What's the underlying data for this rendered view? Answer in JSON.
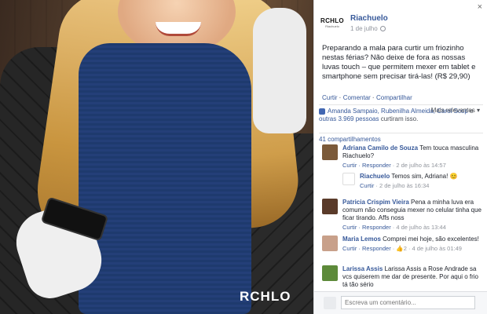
{
  "photo": {
    "logo_text": "RCHLO"
  },
  "panel": {
    "close_glyph": "×",
    "page": {
      "avatar_brand": "RCHLO",
      "avatar_sub": "Riachuelo",
      "name": "Riachuelo",
      "date": "1 de julho",
      "privacy_icon": "globe-icon"
    },
    "post_text": "Preparando a mala para curtir um friozinho nestas férias? Não deixe de fora as nossas luvas touch – que permitem mexer em tablet e smartphone sem precisar tirá-las! (R$ 29,90)",
    "actions": {
      "like": "Curtir",
      "comment": "Comentar",
      "share": "Compartilhar",
      "separator": "·"
    },
    "likes": {
      "names": "Amanda Sampaio, Rubenilha Almeida, Carol Scop",
      "connector": " e ",
      "others": "outras 3.969 pessoas",
      "suffix": " curtiram isso.",
      "sort_label": "Mais relevantes ▾"
    },
    "shares": "41 compartilhamentos",
    "comments": [
      {
        "author": "Adriana Camilo de Souza",
        "text": "Tem touca masculina Riachuelo?",
        "reply_label": "Curtir · Responder",
        "time": " · 2 de julho às 14:57",
        "avatar_color": "#7b5a3a"
      },
      {
        "author": "Patricia Crispim Vieira",
        "text": "Pena a minha luva era comum não conseguia mexer no celular tinha que ficar tirando. Affs noss",
        "reply_label": "Curtir · Responder",
        "time": " · 4 de julho às 13:44",
        "avatar_color": "#5a3b2a"
      },
      {
        "author": "Maria Lemos",
        "text": "Comprei mei hoje, são excelentes!",
        "reply_label": "Curtir · Responder",
        "time": " · 👍2 · 4 de julho às 01:49",
        "avatar_color": "#c8a08a"
      },
      {
        "author": "Larissa Assis",
        "text": "Larissa Assis a Rose Andrade sa vcs quiserem me dar de presente. Por aqui o frio tá tão sério",
        "reply_label": "Curtir · Responder",
        "time": "",
        "avatar_color": "#5d8a3a"
      }
    ],
    "reply": {
      "author": "Riachuelo",
      "text": "Temos sim, Adriana! 😊",
      "reply_label": "Curtir",
      "time": " · 2 de julho às 16:34"
    },
    "composer": {
      "placeholder": "Escreva um comentário..."
    }
  }
}
